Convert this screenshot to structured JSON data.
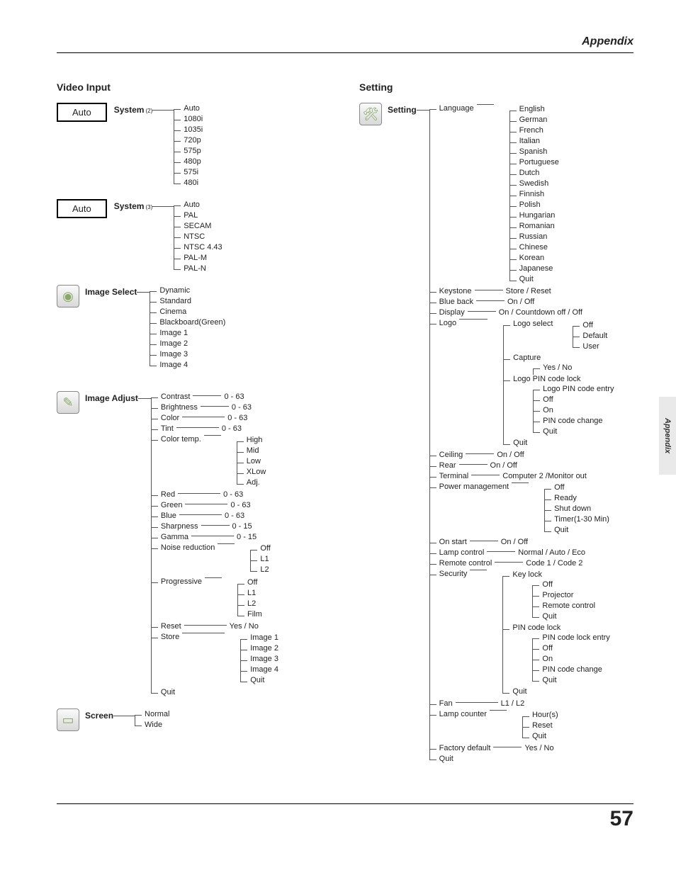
{
  "header": {
    "title": "Appendix",
    "side_tab": "Appendix",
    "page_number": "57"
  },
  "left": {
    "title": "Video Input",
    "auto_label": "Auto",
    "system2": {
      "label": "System",
      "sub": "(2)",
      "items": [
        "Auto",
        "1080i",
        "1035i",
        "720p",
        "575p",
        "480p",
        "575i",
        "480i"
      ]
    },
    "system3": {
      "label": "System",
      "sub": "(3)",
      "items": [
        "Auto",
        "PAL",
        "SECAM",
        "NTSC",
        "NTSC 4.43",
        "PAL-M",
        "PAL-N"
      ]
    },
    "image_select": {
      "label": "Image Select",
      "items": [
        "Dynamic",
        "Standard",
        "Cinema",
        "Blackboard(Green)",
        "Image 1",
        "Image 2",
        "Image 3",
        "Image 4"
      ]
    },
    "image_adjust": {
      "label": "Image Adjust",
      "contrast": {
        "label": "Contrast",
        "range": "0 - 63"
      },
      "brightness": {
        "label": "Brightness",
        "range": "0 - 63"
      },
      "color": {
        "label": "Color",
        "range": "0 - 63"
      },
      "tint": {
        "label": "Tint",
        "range": "0 - 63"
      },
      "color_temp": {
        "label": "Color temp.",
        "items": [
          "High",
          "Mid",
          "Low",
          "XLow",
          "Adj."
        ]
      },
      "red": {
        "label": "Red",
        "range": "0 - 63"
      },
      "green": {
        "label": "Green",
        "range": "0 - 63"
      },
      "blue": {
        "label": "Blue",
        "range": "0 - 63"
      },
      "sharpness": {
        "label": "Sharpness",
        "range": "0 - 15"
      },
      "gamma": {
        "label": "Gamma",
        "range": "0 - 15"
      },
      "noise": {
        "label": "Noise reduction",
        "items": [
          "Off",
          "L1",
          "L2"
        ]
      },
      "progressive": {
        "label": "Progressive",
        "items": [
          "Off",
          "L1",
          "L2",
          "Film"
        ]
      },
      "reset": {
        "label": "Reset",
        "value": "Yes / No"
      },
      "store": {
        "label": "Store",
        "items": [
          "Image 1",
          "Image 2",
          "Image 3",
          "Image 4",
          "Quit"
        ]
      },
      "quit": "Quit"
    },
    "screen": {
      "label": "Screen",
      "items": [
        "Normal",
        "Wide"
      ]
    }
  },
  "right": {
    "title": "Setting",
    "root_label": "Setting",
    "language": {
      "label": "Language",
      "items": [
        "English",
        "German",
        "French",
        "Italian",
        "Spanish",
        "Portuguese",
        "Dutch",
        "Swedish",
        "Finnish",
        "Polish",
        "Hungarian",
        "Romanian",
        "Russian",
        "Chinese",
        "Korean",
        "Japanese",
        "Quit"
      ]
    },
    "keystone": {
      "label": "Keystone",
      "value": "Store / Reset"
    },
    "blue_back": {
      "label": "Blue back",
      "value": "On / Off"
    },
    "display": {
      "label": "Display",
      "value": "On / Countdown off / Off"
    },
    "logo": {
      "label": "Logo",
      "logo_select": {
        "label": "Logo select",
        "items": [
          "Off",
          "Default",
          "User"
        ]
      },
      "capture": {
        "label": "Capture",
        "value": "Yes / No"
      },
      "pin_lock": {
        "label": "Logo PIN code lock",
        "items": [
          "Logo PIN code entry",
          "Off",
          "On",
          "PIN code change",
          "Quit"
        ]
      },
      "quit": "Quit"
    },
    "ceiling": {
      "label": "Ceiling",
      "value": "On / Off"
    },
    "rear": {
      "label": "Rear",
      "value": "On / Off"
    },
    "terminal": {
      "label": "Terminal",
      "value": "Computer 2 /Monitor out"
    },
    "power_mgmt": {
      "label": "Power management",
      "items": [
        "Off",
        "Ready",
        "Shut down",
        "Timer(1-30 Min)",
        "Quit"
      ]
    },
    "on_start": {
      "label": "On start",
      "value": "On / Off"
    },
    "lamp_control": {
      "label": "Lamp control",
      "value": "Normal / Auto / Eco"
    },
    "remote_control": {
      "label": "Remote control",
      "value": "Code 1 / Code 2"
    },
    "security": {
      "label": "Security",
      "key_lock": {
        "label": "Key lock",
        "items": [
          "Off",
          "Projector",
          "Remote control",
          "Quit"
        ]
      },
      "pin_lock": {
        "label": "PIN code lock",
        "items": [
          "PIN code lock entry",
          "Off",
          "On",
          "PIN code change",
          "Quit"
        ]
      },
      "quit": "Quit"
    },
    "fan": {
      "label": "Fan",
      "value": "L1 / L2"
    },
    "lamp_counter": {
      "label": "Lamp counter",
      "items": [
        "Hour(s)",
        "Reset",
        "Quit"
      ]
    },
    "factory_default": {
      "label": "Factory default",
      "value": "Yes / No"
    },
    "quit": "Quit"
  }
}
